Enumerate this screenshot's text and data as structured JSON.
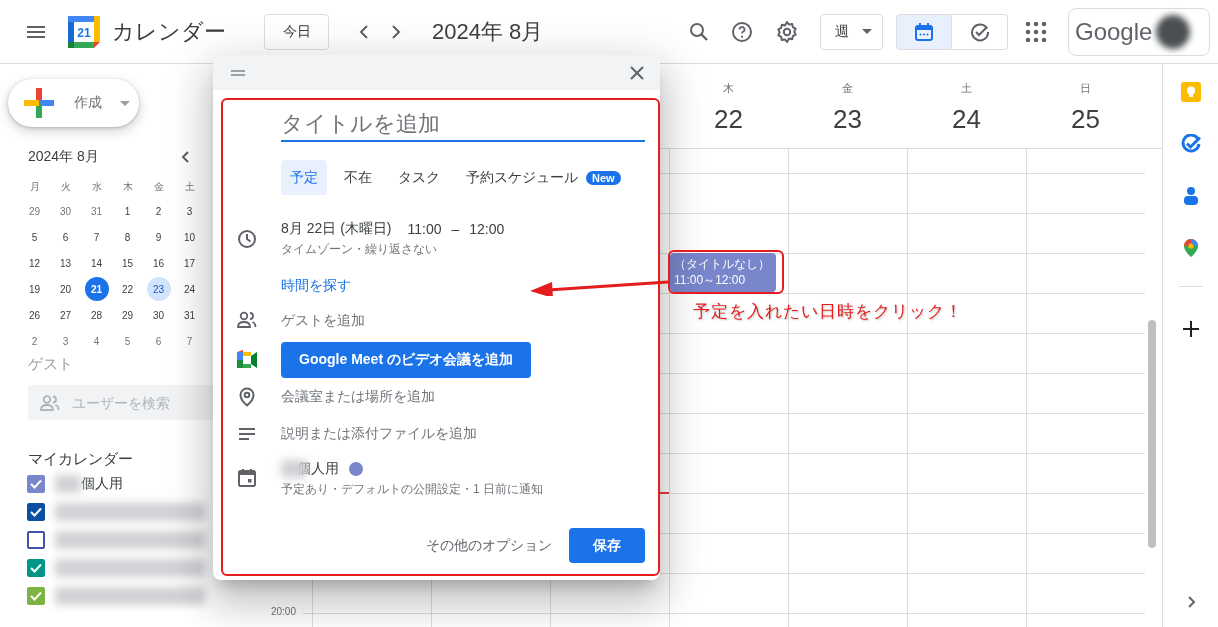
{
  "header": {
    "app_name": "カレンダー",
    "logo_text": "21",
    "today_button": "今日",
    "period": "2024年 8月",
    "view_select": "週",
    "view_toggle": [
      {
        "kind": "calendar",
        "selected": true
      },
      {
        "kind": "tasks",
        "selected": false
      }
    ],
    "account_text": "Google"
  },
  "create_button": {
    "label": "作成"
  },
  "mini_calendar": {
    "title": "2024年 8月",
    "weekdays": [
      "月",
      "火",
      "水",
      "木",
      "金",
      "土"
    ],
    "weeks": [
      [
        {
          "d": "29",
          "other": true,
          "today": false,
          "selected": false
        },
        {
          "d": "30",
          "other": true,
          "today": false,
          "selected": false
        },
        {
          "d": "31",
          "other": true,
          "today": false,
          "selected": false
        },
        {
          "d": "1",
          "other": false,
          "today": false,
          "selected": false
        },
        {
          "d": "2",
          "other": false,
          "today": false,
          "selected": false
        },
        {
          "d": "3",
          "other": false,
          "today": false,
          "selected": false
        }
      ],
      [
        {
          "d": "5",
          "other": false,
          "today": false,
          "selected": false
        },
        {
          "d": "6",
          "other": false,
          "today": false,
          "selected": false
        },
        {
          "d": "7",
          "other": false,
          "today": false,
          "selected": false
        },
        {
          "d": "8",
          "other": false,
          "today": false,
          "selected": false
        },
        {
          "d": "9",
          "other": false,
          "today": false,
          "selected": false
        },
        {
          "d": "10",
          "other": false,
          "today": false,
          "selected": false
        }
      ],
      [
        {
          "d": "12",
          "other": false,
          "today": false,
          "selected": false
        },
        {
          "d": "13",
          "other": false,
          "today": false,
          "selected": false
        },
        {
          "d": "14",
          "other": false,
          "today": false,
          "selected": false
        },
        {
          "d": "15",
          "other": false,
          "today": false,
          "selected": false
        },
        {
          "d": "16",
          "other": false,
          "today": false,
          "selected": false
        },
        {
          "d": "17",
          "other": false,
          "today": false,
          "selected": false
        }
      ],
      [
        {
          "d": "19",
          "other": false,
          "today": false,
          "selected": false
        },
        {
          "d": "20",
          "other": false,
          "today": false,
          "selected": false
        },
        {
          "d": "21",
          "other": false,
          "today": true,
          "selected": false
        },
        {
          "d": "22",
          "other": false,
          "today": false,
          "selected": false
        },
        {
          "d": "23",
          "other": false,
          "today": false,
          "selected": true
        },
        {
          "d": "24",
          "other": false,
          "today": false,
          "selected": false
        }
      ],
      [
        {
          "d": "26",
          "other": false,
          "today": false,
          "selected": false
        },
        {
          "d": "27",
          "other": false,
          "today": false,
          "selected": false
        },
        {
          "d": "28",
          "other": false,
          "today": false,
          "selected": false
        },
        {
          "d": "29",
          "other": false,
          "today": false,
          "selected": false
        },
        {
          "d": "30",
          "other": false,
          "today": false,
          "selected": false
        },
        {
          "d": "31",
          "other": false,
          "today": false,
          "selected": false
        }
      ],
      [
        {
          "d": "2",
          "other": true,
          "today": false,
          "selected": false
        },
        {
          "d": "3",
          "other": true,
          "today": false,
          "selected": false
        },
        {
          "d": "4",
          "other": true,
          "today": false,
          "selected": false
        },
        {
          "d": "5",
          "other": true,
          "today": false,
          "selected": false
        },
        {
          "d": "6",
          "other": true,
          "today": false,
          "selected": false
        },
        {
          "d": "7",
          "other": true,
          "today": false,
          "selected": false
        }
      ]
    ]
  },
  "guests": {
    "heading": "ゲスト",
    "search": {
      "placeholder": "ユーザーを検索"
    }
  },
  "my_calendars": {
    "heading": "マイカレンダー",
    "items": [
      {
        "label": "個人用",
        "checked": true,
        "color": "#7986cb"
      },
      {
        "checked": true,
        "color": "#0b4ea2"
      },
      {
        "checked": false,
        "color": "#3f51b5"
      },
      {
        "checked": true,
        "color": "#009688"
      },
      {
        "checked": true,
        "color": "#7cb342"
      }
    ]
  },
  "week": {
    "days": [
      {
        "weekday": "木",
        "date": "22",
        "events": [
          {
            "title": "（タイトルなし）",
            "time": "11:00～12:00"
          }
        ]
      },
      {
        "weekday": "金",
        "date": "23"
      },
      {
        "weekday": "土",
        "date": "24"
      },
      {
        "weekday": "日",
        "date": "25"
      }
    ],
    "time_labels": [
      "20:00"
    ]
  },
  "dialog": {
    "title_placeholder": "タイトルを追加",
    "tabs": [
      {
        "label": "予定",
        "selected": true
      },
      {
        "label": "不在",
        "selected": false
      },
      {
        "label": "タスク",
        "selected": false
      },
      {
        "label": "予約スケジュール",
        "badge": "New",
        "selected": false
      }
    ],
    "date": "8月 22日 (木曜日)",
    "start": "11:00",
    "dash": "–",
    "end": "12:00",
    "recurrence": "タイムゾーン・繰り返さない",
    "find_time": "時間を探す",
    "add_guests": "ゲストを追加",
    "meet_button": "Google Meet のビデオ会議を追加",
    "location": "会議室または場所を追加",
    "description": "説明または添付ファイルを追加",
    "calendar": {
      "name": "個人用",
      "color": "#7986cb",
      "details": "予定あり・デフォルトの公開設定・1 日前に通知"
    },
    "more_options": "その他のオプション",
    "save": "保存"
  },
  "annotation": {
    "text": "予定を入れたい日時をクリック！"
  }
}
